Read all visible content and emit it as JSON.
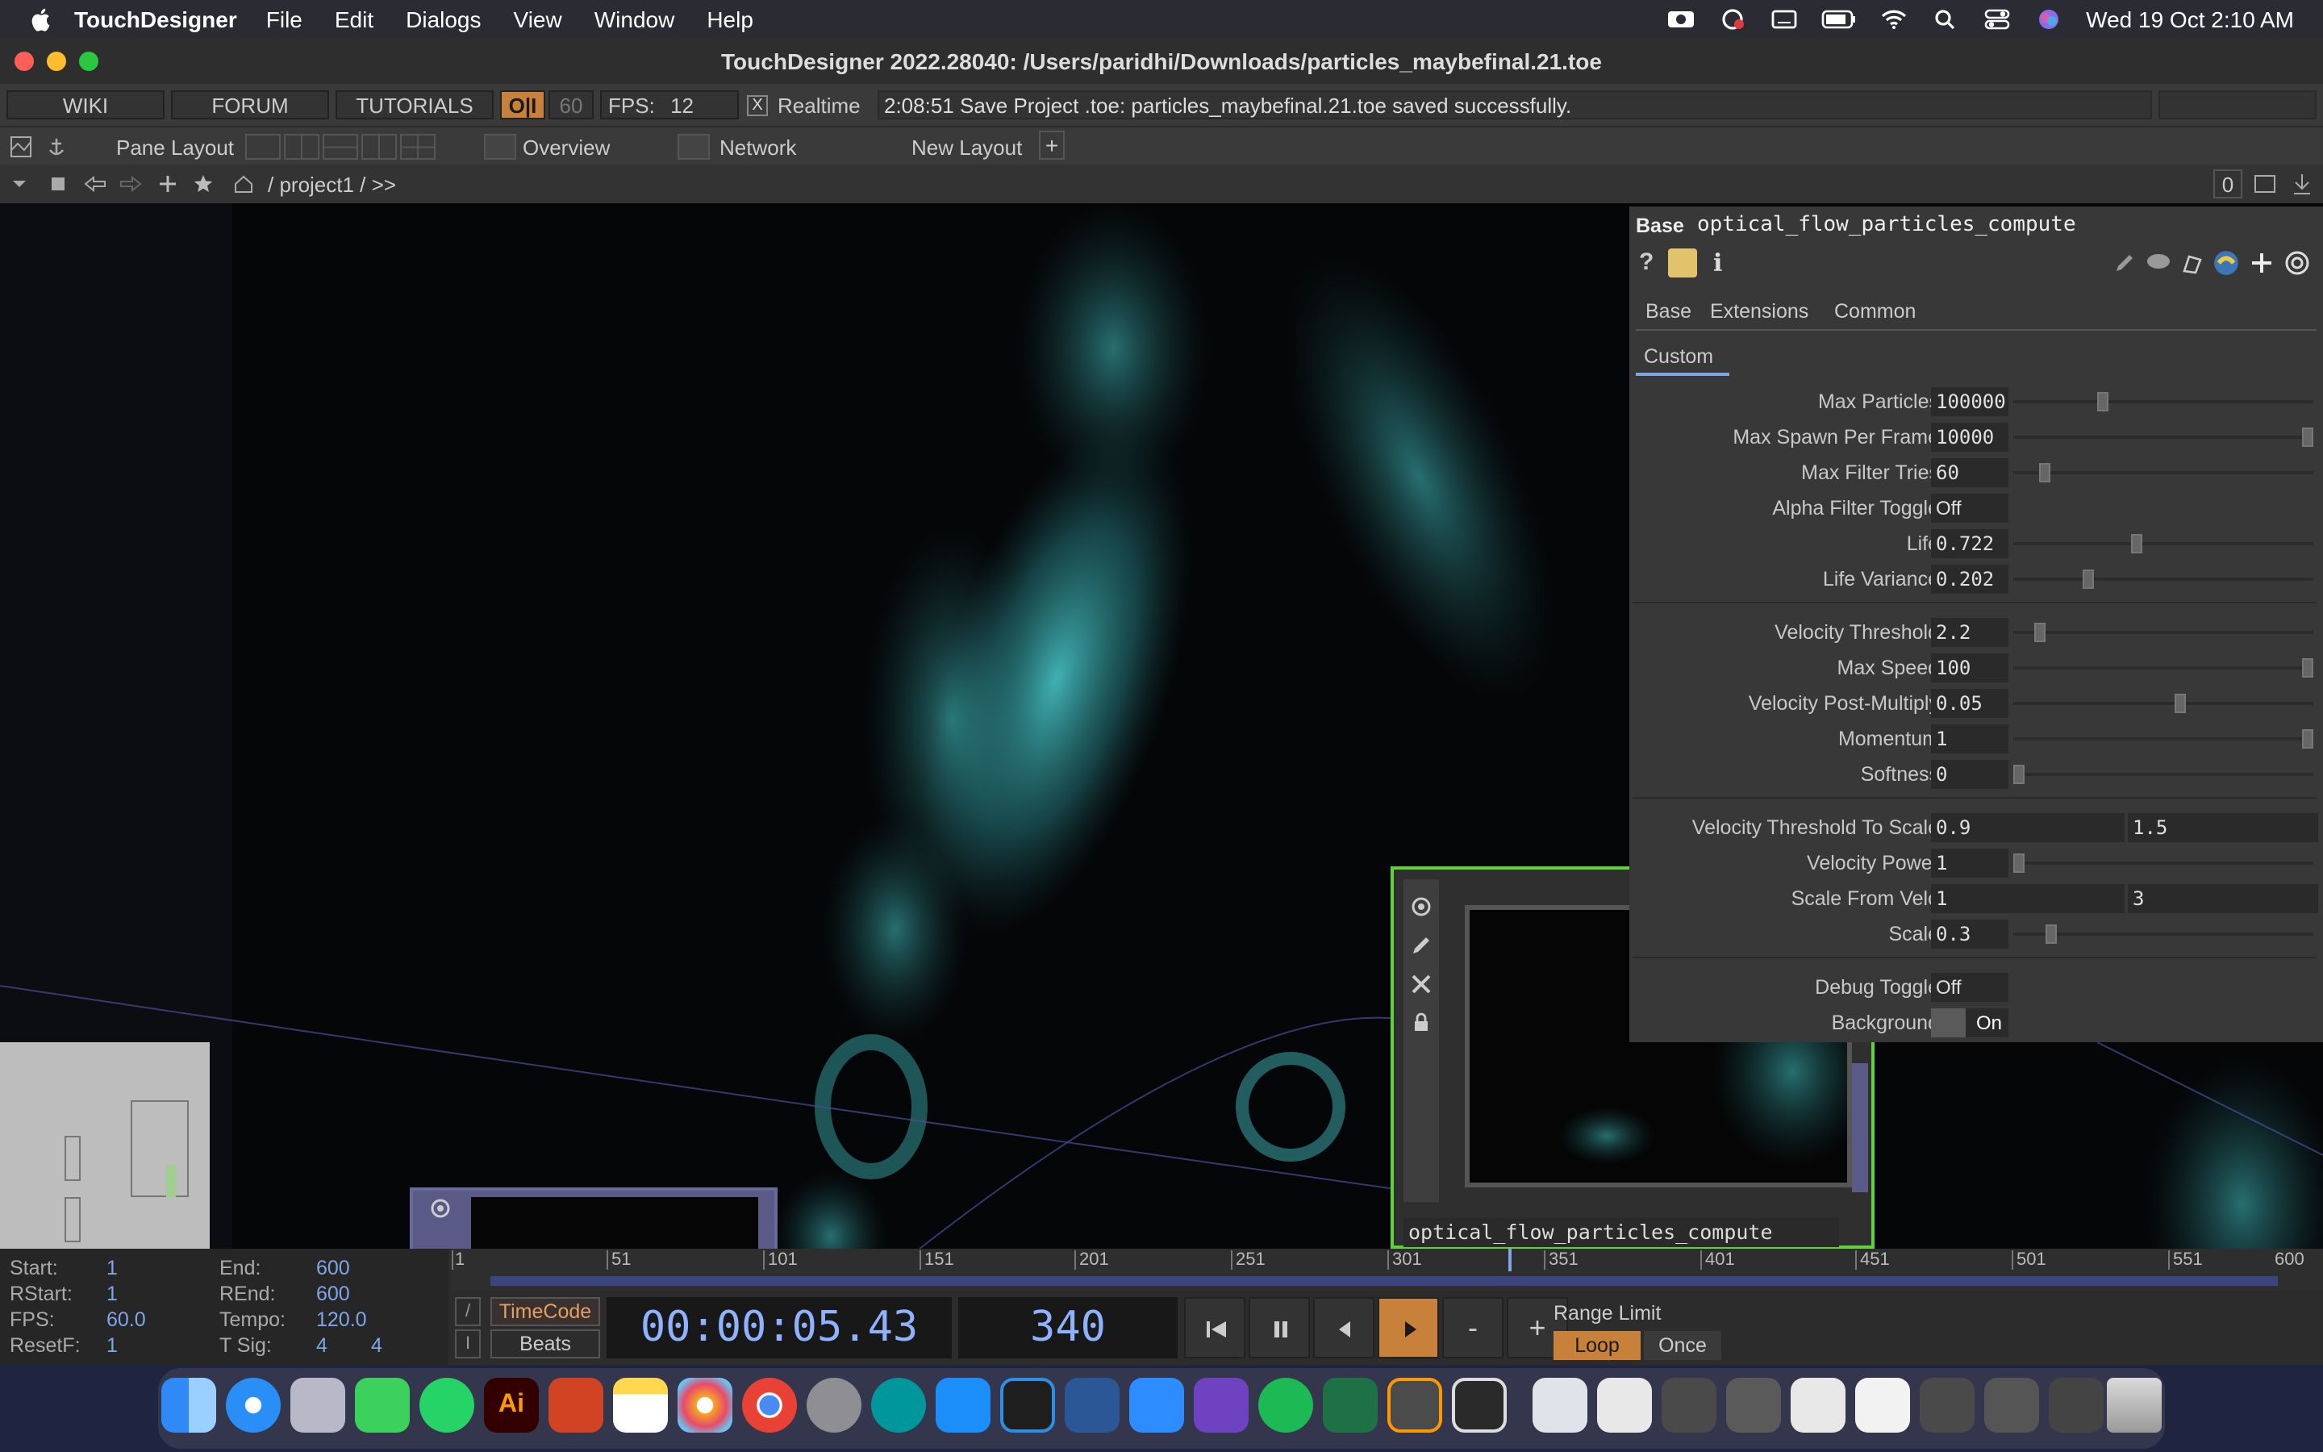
{
  "menubar": {
    "app_name": "TouchDesigner",
    "items": [
      "File",
      "Edit",
      "Dialogs",
      "View",
      "Window",
      "Help"
    ],
    "datetime": "Wed 19 Oct  2:10 AM"
  },
  "window": {
    "title": "TouchDesigner 2022.28040: /Users/paridhi/Downloads/particles_maybefinal.21.toe"
  },
  "topbar": {
    "wiki": "WIKI",
    "forum": "FORUM",
    "tutorials": "TUTORIALS",
    "oi": "O|I",
    "fps_target": "60",
    "fps_label": "FPS:",
    "fps_value": "12",
    "realtime_check": "X",
    "realtime_label": "Realtime",
    "status_message": "2:08:51 Save Project .toe: particles_maybefinal.21.toe saved successfully."
  },
  "layoutbar": {
    "pane_layout": "Pane Layout",
    "overview": "Overview",
    "network": "Network",
    "new_layout": "New Layout",
    "plus": "+"
  },
  "pathbar": {
    "path": "/ project1 / >>",
    "count": "0"
  },
  "params": {
    "type_label": "Base",
    "op_name": "optical_flow_particles_compute",
    "tabs": [
      "Base",
      "Extensions",
      "Common"
    ],
    "active_page": "Custom",
    "rows": [
      {
        "label": "Max Particles",
        "value": "100000",
        "slider": 0.29
      },
      {
        "label": "Max Spawn Per Frame",
        "value": "10000",
        "slider": 1.0
      },
      {
        "label": "Max Filter Tries",
        "value": "60",
        "slider": 0.09
      },
      {
        "label": "Alpha Filter Toggle",
        "value": "Off"
      },
      {
        "label": "Life",
        "value": "0.722",
        "slider": 0.41
      },
      {
        "label": "Life Variance",
        "value": "0.202",
        "slider": 0.24
      },
      {
        "label": "Velocity Threshold",
        "value": "2.2",
        "slider": 0.07
      },
      {
        "label": "Max Speed",
        "value": "100",
        "slider": 1.0
      },
      {
        "label": "Velocity Post-Multiply",
        "value": "0.05",
        "slider": 0.56
      },
      {
        "label": "Momentum",
        "value": "1",
        "slider": 1.0
      },
      {
        "label": "Softness",
        "value": "0",
        "slider": 0.0
      },
      {
        "label": "Velocity Threshold To Scale",
        "value": "0.9",
        "value2": "1.5"
      },
      {
        "label": "Velocity Power",
        "value": "1",
        "slider": 0.0
      },
      {
        "label": "Scale From Velo",
        "value": "1",
        "value2": "3"
      },
      {
        "label": "Scale",
        "value": "0.3",
        "slider": 0.11
      },
      {
        "label": "Debug Toggle",
        "value": "Off"
      },
      {
        "label": "Background",
        "value": "On"
      }
    ]
  },
  "network": {
    "node_name": "optical_flow_particles_compute"
  },
  "timeline": {
    "start_label": "Start:",
    "start": "1",
    "end_label": "End:",
    "end": "600",
    "rstart_label": "RStart:",
    "rstart": "1",
    "rend_label": "REnd:",
    "rend": "600",
    "fps_label": "FPS:",
    "fps": "60.0",
    "tempo_label": "Tempo:",
    "tempo": "120.0",
    "resetf_label": "ResetF:",
    "resetf": "1",
    "tsig_label": "T Sig:",
    "tsig1": "4",
    "tsig2": "4",
    "ticks": [
      "1",
      "51",
      "101",
      "151",
      "201",
      "251",
      "301",
      "351",
      "401",
      "451",
      "501",
      "551",
      "600"
    ],
    "timecode_btn": "TimeCode",
    "beats_btn": "Beats",
    "timecode": "00:00:05.43",
    "frame": "340",
    "minus": "-",
    "plus": "+",
    "range_limit": "Range Limit",
    "loop": "Loop",
    "once": "Once"
  },
  "colors": {
    "accent_orange": "#c8813a",
    "particles": "#3fb6b8",
    "node_border": "#5fd23a",
    "timecode_text": "#8fb2ff"
  }
}
